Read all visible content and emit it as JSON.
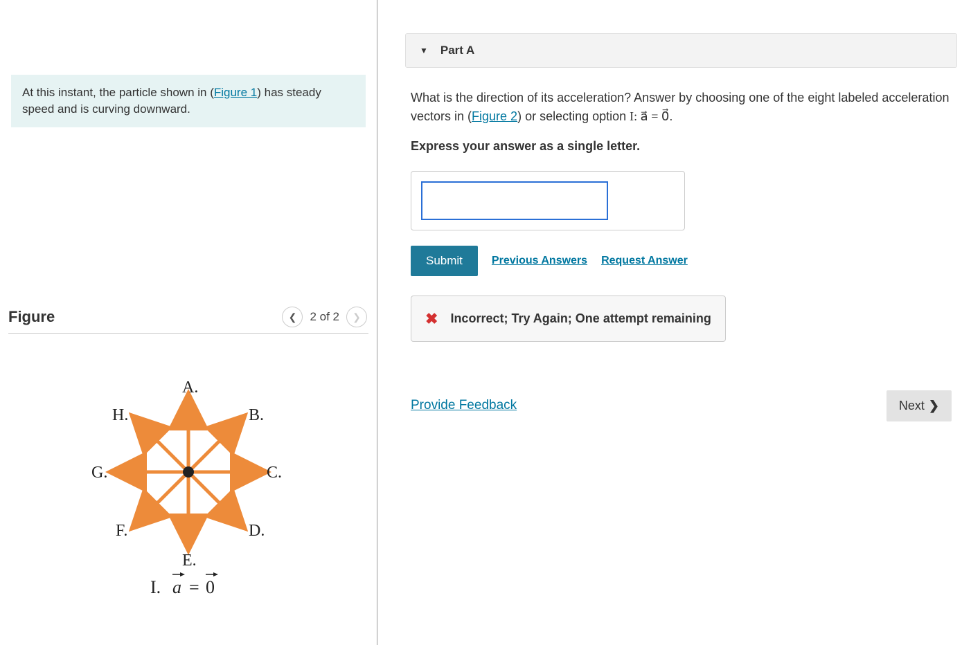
{
  "problem": {
    "text_before": "At this instant, the particle shown in (",
    "figure_link": "Figure 1",
    "text_after": ") has steady speed and is curving downward."
  },
  "figure": {
    "title": "Figure",
    "counter": "2 of 2",
    "labels": {
      "A": "A.",
      "B": "B.",
      "C": "C.",
      "D": "D.",
      "E": "E.",
      "F": "F.",
      "G": "G.",
      "H": "H."
    },
    "option_I": "I. a⃗ = 0⃗"
  },
  "part": {
    "title": "Part A",
    "question_before": "What is the direction of its acceleration? Answer by choosing one of the eight labeled acceleration vectors in (",
    "figure2_link": "Figure 2",
    "question_mid": ") or selecting option ",
    "option_I_math": "I: a⃗ = 0⃗",
    "question_after": ".",
    "instruction": "Express your answer as a single letter.",
    "submit": "Submit",
    "prev_answers": "Previous Answers",
    "request_answer": "Request Answer",
    "feedback": "Incorrect; Try Again; One attempt remaining"
  },
  "footer": {
    "provide_feedback": "Provide Feedback",
    "next": "Next"
  }
}
